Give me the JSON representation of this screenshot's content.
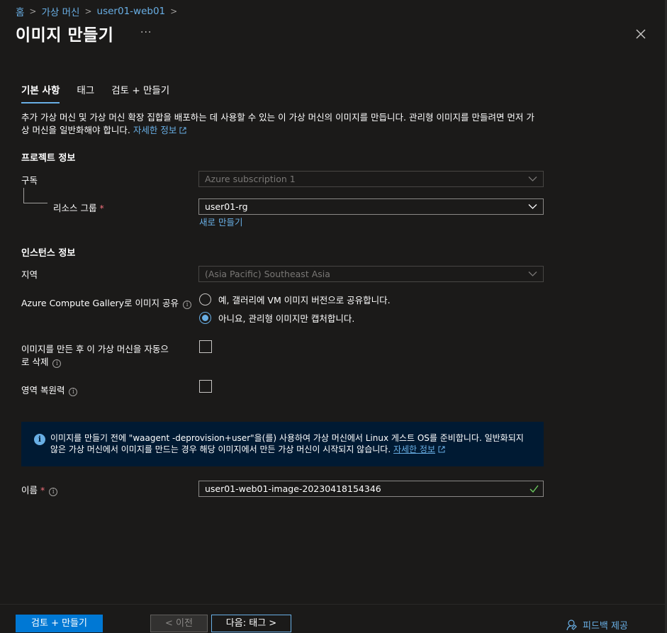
{
  "breadcrumb": [
    "홈",
    "가상 머신",
    "user01-web01"
  ],
  "page": {
    "title": "이미지 만들기",
    "more": "···"
  },
  "tabs": [
    "기본 사항",
    "태그",
    "검토 + 만들기"
  ],
  "description": {
    "text": "추가 가상 머신 및 가상 머신 확장 집합을 배포하는 데 사용할 수 있는 이 가상 머신의 이미지를 만듭니다. 관리형 이미지를 만들려면 먼저 가상 머신을 일반화해야 합니다. ",
    "link": "자세한 정보"
  },
  "project": {
    "heading": "프로젝트 정보",
    "subscription_label": "구독",
    "subscription_value": "Azure subscription 1",
    "rg_label": "리소스 그룹",
    "rg_value": "user01-rg",
    "new_link": "새로 만들기"
  },
  "instance": {
    "heading": "인스턴스 정보",
    "region_label": "지역",
    "region_value": "(Asia Pacific) Southeast Asia",
    "gallery_label": "Azure Compute Gallery로 이미지 공유",
    "gallery_options": [
      "예, 갤러리에 VM 이미지 버전으로 공유합니다.",
      "아니요, 관리형 이미지만 캡처합니다."
    ],
    "gallery_selected": 1,
    "autodelete_label_1": "이미지를 만든 후 이 가상 머신을 자동으",
    "autodelete_label_2": "로 삭제",
    "autodelete_checked": false,
    "zone_label": "영역 복원력",
    "zone_checked": false
  },
  "banner": {
    "text": "이미지를 만들기 전에 \"waagent -deprovision+user\"을(를) 사용하여 가상 머신에서 Linux 게스트 OS를 준비합니다. 일반화되지 않은 가상 머신에서 이미지를 만드는 경우 해당 이미지에서 만든 가상 머신이 시작되지 않습니다. ",
    "link": "자세한 정보"
  },
  "name": {
    "label": "이름",
    "value": "user01-web01-image-20230418154346"
  },
  "footer": {
    "review_create": "검토 + 만들기",
    "prev": "< 이전",
    "next": "다음: 태그 >",
    "feedback": "피드백 제공"
  },
  "colors": {
    "accent": "#69afe5",
    "primary_button": "#0078d4",
    "background": "#1b1a19",
    "banner": "#001a33"
  }
}
